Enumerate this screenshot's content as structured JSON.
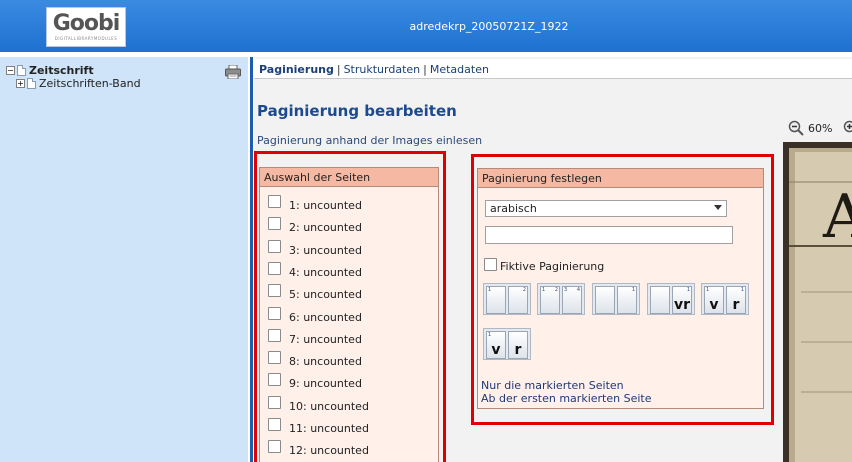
{
  "header": {
    "logo_text": "Goobi",
    "logo_subtext": "DIGITALLIBRARYMODULES",
    "title": "adredekrp_20050721Z_1922"
  },
  "sidebar": {
    "tree": [
      {
        "label": "Zeitschrift",
        "toggle": "−"
      },
      {
        "label": "Zeitschriften-Band",
        "toggle": "+"
      }
    ],
    "print_icon": "printer-icon"
  },
  "tabs": [
    {
      "label": "Paginierung"
    },
    {
      "label": "Strukturdaten"
    },
    {
      "label": "Metadaten"
    }
  ],
  "tab_separator": "|",
  "main": {
    "heading": "Paginierung bearbeiten",
    "subtext": "Paginierung anhand der Images einlesen"
  },
  "pages_panel": {
    "title": "Auswahl der Seiten",
    "items": [
      "1: uncounted",
      "2: uncounted",
      "3: uncounted",
      "4: uncounted",
      "5: uncounted",
      "6: uncounted",
      "7: uncounted",
      "8: uncounted",
      "9: uncounted",
      "10: uncounted",
      "11: uncounted",
      "12: uncounted"
    ]
  },
  "pagination_panel": {
    "title": "Paginierung festlegen",
    "select_value": "arabisch",
    "input_value": "",
    "fictive_label": "Fiktive Paginierung",
    "mode_labels": [
      "vr",
      "v",
      "r",
      "v",
      "r"
    ],
    "page_numbers": [
      "1",
      "2",
      "3",
      "4"
    ],
    "link_marked": "Nur die markierten Seiten",
    "link_from_first": "Ab der ersten markierten Seite"
  },
  "viewer": {
    "zoom": "60%",
    "zoom_out_icon": "zoom-out-icon",
    "zoom_in_icon": "zoom-in-icon",
    "image_text": "A"
  },
  "colors": {
    "header_blue": "#1d6fd0",
    "accent_red": "#e00000",
    "panel_bg": "#fff0ea",
    "panel_header": "#f5b9a3",
    "sidebar_bg": "#cfe4f8"
  }
}
